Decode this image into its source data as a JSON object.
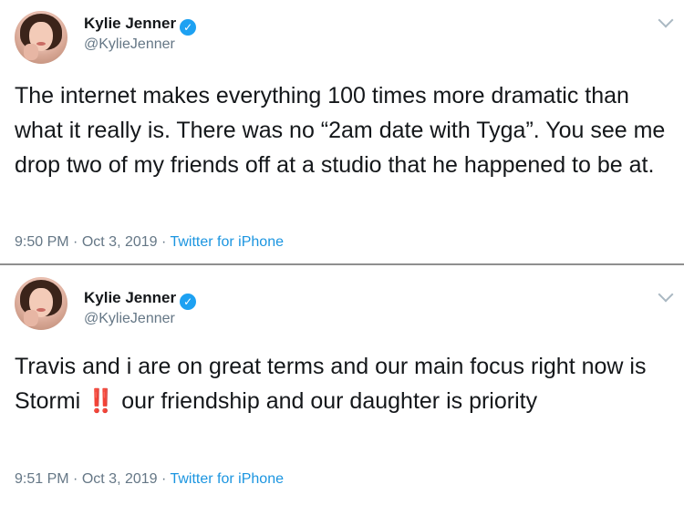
{
  "tweets": [
    {
      "display_name": "Kylie Jenner",
      "handle": "@KylieJenner",
      "text": "The internet makes everything 100 times more dramatic than what it really is. There was no “2am date with Tyga”. You see me drop two of my friends off at a studio that he happened to be at.",
      "time": "9:50 PM",
      "date": "Oct 3, 2019",
      "source": "Twitter for iPhone",
      "separator": "·"
    },
    {
      "display_name": "Kylie Jenner",
      "handle": "@KylieJenner",
      "text_before": "Travis and i are on great terms and our main focus right now is Stormi ",
      "emoji": "‼️",
      "text_after": " our friendship and our daughter is priority",
      "time": "9:51 PM",
      "date": "Oct 3, 2019",
      "source": "Twitter for iPhone",
      "separator": "·"
    }
  ],
  "colors": {
    "text": "#14171a",
    "secondary": "#657786",
    "link": "#1b95e0",
    "verified": "#1da1f2",
    "divider": "#8f8f8f"
  },
  "icons": {
    "verified": "verified-badge-icon",
    "menu": "chevron-down-icon"
  }
}
